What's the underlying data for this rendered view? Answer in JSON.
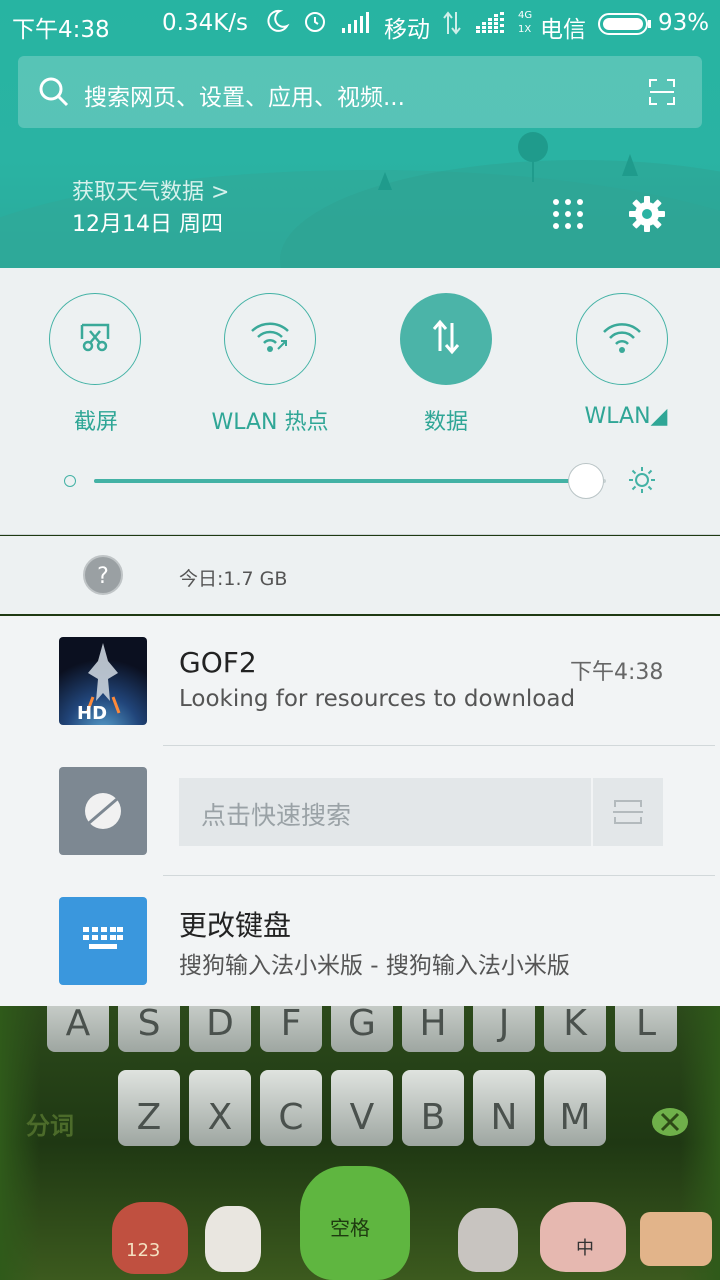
{
  "status_bar": {
    "time": "下午4:38",
    "speed": "0.34K/s",
    "carrier1": "移动",
    "net_4g": "4G",
    "net_1x": "1X",
    "carrier2": "电信",
    "battery": "93%"
  },
  "search": {
    "placeholder": "搜索网页、设置、应用、视频..."
  },
  "weather": {
    "link": "获取天气数据 >",
    "date": "12月14日 周四"
  },
  "quick_tiles": [
    {
      "label": "截屏",
      "icon": "scissors-icon",
      "active": false
    },
    {
      "label": "WLAN 热点",
      "icon": "hotspot-icon",
      "active": false
    },
    {
      "label": "数据",
      "icon": "data-arrows-icon",
      "active": true
    },
    {
      "label": "WLAN◢",
      "icon": "wifi-icon",
      "active": false
    }
  ],
  "brightness": {
    "level": 0.96
  },
  "data_usage": {
    "text": "今日:1.7 GB"
  },
  "notifications": {
    "gof2": {
      "title": "GOF2",
      "time": "下午4:38",
      "text": "Looking for resources to download",
      "icon_label": "HD"
    },
    "quick_search": {
      "placeholder": "点击快速搜索"
    },
    "keyboard": {
      "title": "更改键盘",
      "text": "搜狗输入法小米版 - 搜狗输入法小米版"
    }
  },
  "keyboard_bg": {
    "row1": [
      "A",
      "S",
      "D",
      "F",
      "G",
      "H",
      "J",
      "K",
      "L"
    ],
    "row2": [
      "Z",
      "X",
      "C",
      "V",
      "B",
      "N",
      "M"
    ],
    "left_label": "分词",
    "bottom_labels": [
      "123",
      "空格",
      "中"
    ]
  },
  "colors": {
    "accent": "#2ab3a3",
    "tile_active": "#4bb4a8",
    "keyboard_icon_bg": "#3a97dd"
  }
}
